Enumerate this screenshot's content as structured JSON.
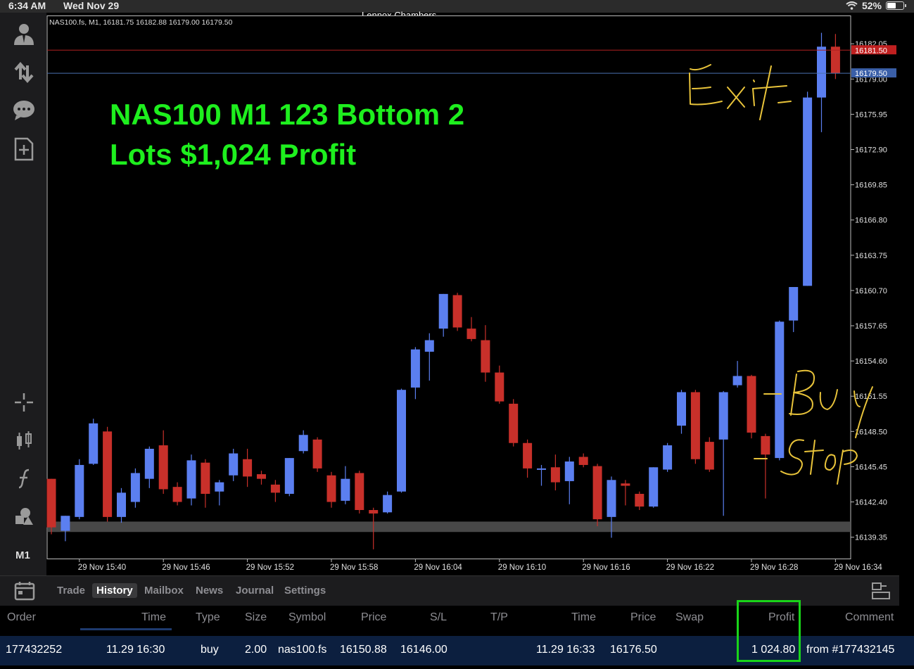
{
  "status_bar": {
    "time": "6:34 AM",
    "date": "Wed Nov 29",
    "owner": "Lennox Chambers",
    "battery": "52%"
  },
  "toolbar": {
    "icons": [
      "account-icon",
      "trade-arrows-icon",
      "chat-icon",
      "new-document-icon",
      "crosshair-icon",
      "chart-type-icon",
      "indicator-icon",
      "objects-icon"
    ],
    "timeframe": "M1"
  },
  "chart": {
    "ohlc_header": "NAS100.fs, M1, 16181.75 16182.88 16179.00 16179.50",
    "headline_line1": "NAS100 M1 123 Bottom 2",
    "headline_line2": "Lots $1,024 Profit",
    "annotations": [
      "Exit",
      "Buy Stop"
    ],
    "colors": {
      "bull": "#5b7ff0",
      "bear": "#c8302a",
      "headline": "#1eef1e",
      "annotation": "#e8c33a"
    }
  },
  "chart_data": {
    "type": "candlestick",
    "symbol": "NAS100.fs",
    "timeframe": "M1",
    "price_ticks": [
      "16182.05",
      "16179.00",
      "16175.95",
      "16172.90",
      "16169.85",
      "16166.80",
      "16163.75",
      "16160.70",
      "16157.65",
      "16154.60",
      "16151.55",
      "16148.50",
      "16145.45",
      "16142.40",
      "16139.35"
    ],
    "time_ticks": [
      "29 Nov 15:40",
      "29 Nov 15:46",
      "29 Nov 15:52",
      "29 Nov 15:58",
      "29 Nov 16:04",
      "29 Nov 16:10",
      "29 Nov 16:16",
      "29 Nov 16:22",
      "29 Nov 16:28",
      "29 Nov 16:34"
    ],
    "ylim": [
      16137.5,
      16184.5
    ],
    "ask_line": "16181.50",
    "bid_line": "16179.50",
    "support_zone": [
      16139.8,
      16140.7
    ],
    "candles": [
      {
        "o": 16144.4,
        "h": 16144.4,
        "l": 16139.6,
        "c": 16140.2
      },
      {
        "o": 16139.9,
        "h": 16141.2,
        "l": 16139.0,
        "c": 16141.2
      },
      {
        "o": 16141.1,
        "h": 16146.1,
        "l": 16140.9,
        "c": 16145.6
      },
      {
        "o": 16145.7,
        "h": 16149.6,
        "l": 16145.6,
        "c": 16149.2
      },
      {
        "o": 16148.5,
        "h": 16148.9,
        "l": 16140.7,
        "c": 16141.1
      },
      {
        "o": 16141.1,
        "h": 16143.6,
        "l": 16140.6,
        "c": 16143.2
      },
      {
        "o": 16142.4,
        "h": 16145.3,
        "l": 16141.9,
        "c": 16144.9
      },
      {
        "o": 16144.4,
        "h": 16147.2,
        "l": 16143.6,
        "c": 16147.0
      },
      {
        "o": 16147.3,
        "h": 16148.6,
        "l": 16143.1,
        "c": 16143.5
      },
      {
        "o": 16143.7,
        "h": 16144.1,
        "l": 16142.1,
        "c": 16142.4
      },
      {
        "o": 16142.7,
        "h": 16146.5,
        "l": 16142.1,
        "c": 16146.0
      },
      {
        "o": 16145.8,
        "h": 16146.1,
        "l": 16141.9,
        "c": 16143.1
      },
      {
        "o": 16143.3,
        "h": 16144.3,
        "l": 16142.1,
        "c": 16144.1
      },
      {
        "o": 16144.7,
        "h": 16147.0,
        "l": 16144.2,
        "c": 16146.6
      },
      {
        "o": 16146.1,
        "h": 16147.0,
        "l": 16143.7,
        "c": 16144.6
      },
      {
        "o": 16144.8,
        "h": 16145.1,
        "l": 16143.9,
        "c": 16144.4
      },
      {
        "o": 16143.9,
        "h": 16144.3,
        "l": 16142.4,
        "c": 16143.2
      },
      {
        "o": 16143.1,
        "h": 16146.2,
        "l": 16142.9,
        "c": 16146.2
      },
      {
        "o": 16146.8,
        "h": 16148.6,
        "l": 16146.6,
        "c": 16148.2
      },
      {
        "o": 16147.8,
        "h": 16148.0,
        "l": 16145.0,
        "c": 16145.3
      },
      {
        "o": 16144.7,
        "h": 16145.0,
        "l": 16141.9,
        "c": 16142.4
      },
      {
        "o": 16142.5,
        "h": 16145.5,
        "l": 16142.2,
        "c": 16144.4
      },
      {
        "o": 16144.9,
        "h": 16145.1,
        "l": 16141.4,
        "c": 16141.7
      },
      {
        "o": 16141.7,
        "h": 16141.9,
        "l": 16138.3,
        "c": 16141.4
      },
      {
        "o": 16141.5,
        "h": 16143.3,
        "l": 16141.4,
        "c": 16143.0
      },
      {
        "o": 16143.3,
        "h": 16152.2,
        "l": 16143.2,
        "c": 16152.1
      },
      {
        "o": 16152.3,
        "h": 16155.8,
        "l": 16151.3,
        "c": 16155.6
      },
      {
        "o": 16155.4,
        "h": 16157.0,
        "l": 16152.9,
        "c": 16156.4
      },
      {
        "o": 16157.4,
        "h": 16160.4,
        "l": 16156.7,
        "c": 16160.4
      },
      {
        "o": 16160.3,
        "h": 16160.5,
        "l": 16157.2,
        "c": 16157.5
      },
      {
        "o": 16157.4,
        "h": 16158.4,
        "l": 16156.3,
        "c": 16156.5
      },
      {
        "o": 16156.4,
        "h": 16157.7,
        "l": 16152.8,
        "c": 16153.6
      },
      {
        "o": 16153.6,
        "h": 16154.2,
        "l": 16150.9,
        "c": 16151.1
      },
      {
        "o": 16150.9,
        "h": 16151.3,
        "l": 16147.2,
        "c": 16147.5
      },
      {
        "o": 16147.5,
        "h": 16147.8,
        "l": 16144.5,
        "c": 16145.3
      },
      {
        "o": 16145.2,
        "h": 16145.6,
        "l": 16143.8,
        "c": 16145.3
      },
      {
        "o": 16145.4,
        "h": 16146.5,
        "l": 16143.4,
        "c": 16144.1
      },
      {
        "o": 16144.2,
        "h": 16146.3,
        "l": 16142.2,
        "c": 16145.9
      },
      {
        "o": 16146.3,
        "h": 16146.6,
        "l": 16145.4,
        "c": 16145.6
      },
      {
        "o": 16145.5,
        "h": 16145.7,
        "l": 16140.3,
        "c": 16140.9
      },
      {
        "o": 16141.1,
        "h": 16144.6,
        "l": 16139.3,
        "c": 16144.3
      },
      {
        "o": 16144.0,
        "h": 16144.3,
        "l": 16142.1,
        "c": 16143.8
      },
      {
        "o": 16143.1,
        "h": 16143.3,
        "l": 16141.7,
        "c": 16142.0
      },
      {
        "o": 16142.0,
        "h": 16145.4,
        "l": 16141.9,
        "c": 16145.4
      },
      {
        "o": 16145.2,
        "h": 16147.5,
        "l": 16145.0,
        "c": 16147.3
      },
      {
        "o": 16149.0,
        "h": 16152.1,
        "l": 16148.3,
        "c": 16151.9
      },
      {
        "o": 16151.9,
        "h": 16152.1,
        "l": 16145.7,
        "c": 16146.1
      },
      {
        "o": 16147.6,
        "h": 16148.0,
        "l": 16145.0,
        "c": 16145.2
      },
      {
        "o": 16147.8,
        "h": 16152.0,
        "l": 16141.2,
        "c": 16151.9
      },
      {
        "o": 16152.5,
        "h": 16154.6,
        "l": 16152.3,
        "c": 16153.3
      },
      {
        "o": 16153.3,
        "h": 16153.4,
        "l": 16147.9,
        "c": 16148.4
      },
      {
        "o": 16148.1,
        "h": 16148.3,
        "l": 16142.7,
        "c": 16146.5
      },
      {
        "o": 16146.2,
        "h": 16158.1,
        "l": 16146.0,
        "c": 16158.0
      },
      {
        "o": 16158.1,
        "h": 16161.0,
        "l": 16157.1,
        "c": 16161.0
      },
      {
        "o": 16161.1,
        "h": 16177.9,
        "l": 16161.1,
        "c": 16177.4
      },
      {
        "o": 16177.4,
        "h": 16183.0,
        "l": 16174.4,
        "c": 16181.8
      },
      {
        "o": 16181.8,
        "h": 16182.9,
        "l": 16179.0,
        "c": 16179.5
      }
    ]
  },
  "tabs": [
    "Trade",
    "History",
    "Mailbox",
    "News",
    "Journal",
    "Settings"
  ],
  "active_tab": "History",
  "table": {
    "headers": [
      "Order",
      "Time",
      "Type",
      "Size",
      "Symbol",
      "Price",
      "S/L",
      "T/P",
      "Time",
      "Price",
      "Swap",
      "Profit",
      "Comment"
    ],
    "row": [
      "177432252",
      "11.29 16:30",
      "buy",
      "2.00",
      "nas100.fs",
      "16150.88",
      "16146.00",
      "",
      "11.29 16:33",
      "16176.50",
      "",
      "1 024.80",
      "from #177432145"
    ]
  }
}
